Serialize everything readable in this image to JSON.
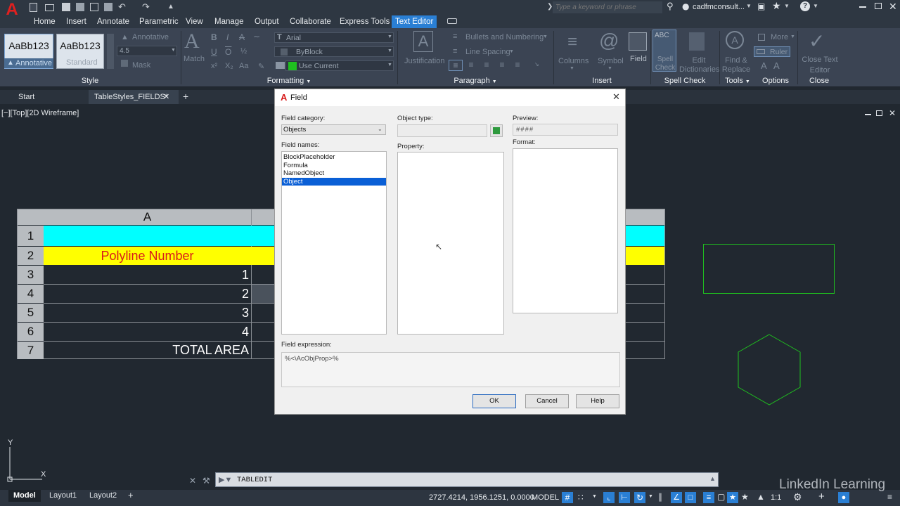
{
  "titlebar": {
    "search_placeholder": "Type a keyword or phrase",
    "user": "cadfmconsult...",
    "icons": [
      "autocad-logo-icon",
      "open-icon",
      "save-icon",
      "undo-icon",
      "redo-icon",
      "search-icon",
      "user-icon",
      "cart-icon",
      "help-icon",
      "minimize-icon",
      "restore-icon",
      "close-icon"
    ]
  },
  "ribbon_tabs": [
    "Home",
    "Insert",
    "Annotate",
    "Parametric",
    "View",
    "Manage",
    "Output",
    "Collaborate",
    "Express Tools",
    "Text Editor"
  ],
  "active_tab": "Text Editor",
  "ribbon": {
    "style": {
      "styles": [
        "AaBb123",
        "AaBb123"
      ],
      "style_names": [
        "Annotative",
        "Standard"
      ],
      "annotative": "Annotative",
      "height": "4.5",
      "mask": "Mask",
      "label": "Style"
    },
    "formatting": {
      "match": "Match",
      "font": "Arial",
      "color": "ByBlock",
      "layer": "Use Current",
      "label": "Formatting"
    },
    "paragraph": {
      "justification": "Justification",
      "bullets": "Bullets and Numbering",
      "spacing": "Line Spacing",
      "label": "Paragraph"
    },
    "insert": {
      "columns": "Columns",
      "symbol": "Symbol",
      "field": "Field",
      "label": "Insert"
    },
    "spell": {
      "spell_check": "Spell Check",
      "edit_dict": "Edit Dictionaries",
      "label": "Spell Check"
    },
    "tools": {
      "find_replace": "Find & Replace",
      "label": "Tools"
    },
    "options": {
      "more": "More",
      "ruler": "Ruler",
      "label": "Options"
    },
    "close": {
      "close_editor": "Close Text Editor",
      "label": "Close"
    }
  },
  "doc_tabs": [
    "Start",
    "TableStyles_FIELDS*"
  ],
  "viewport_label": "[−][Top][2D Wireframe]",
  "table": {
    "column_header": "A",
    "rows": [
      "1",
      "2",
      "3",
      "4",
      "5",
      "6",
      "7"
    ],
    "cells": [
      "",
      "Polyline Number",
      "1",
      "2",
      "3",
      "4",
      "TOTAL AREA"
    ],
    "colors": {
      "row1": "#00ffff",
      "row2": "#ffff00",
      "row2_text": "#d81b1b"
    }
  },
  "dialog": {
    "title": "Field",
    "field_category_label": "Field category:",
    "field_category_value": "Objects",
    "field_names_label": "Field names:",
    "field_names": [
      "BlockPlaceholder",
      "Formula",
      "NamedObject",
      "Object"
    ],
    "selected_field": "Object",
    "object_type_label": "Object type:",
    "property_label": "Property:",
    "preview_label": "Preview:",
    "preview_value": "####",
    "format_label": "Format:",
    "expression_label": "Field expression:",
    "expression_value": "%<\\AcObjProp>%",
    "ok": "OK",
    "cancel": "Cancel",
    "help": "Help"
  },
  "command_line": {
    "value": "TABLEDIT"
  },
  "layout_tabs": [
    "Model",
    "Layout1",
    "Layout2"
  ],
  "status": {
    "coords": "2727.4214, 1956.1251, 0.0000",
    "mode": "MODEL",
    "scale": "1:1"
  },
  "watermark": "LinkedIn Learning",
  "ucs": {
    "x": "X",
    "y": "Y"
  }
}
